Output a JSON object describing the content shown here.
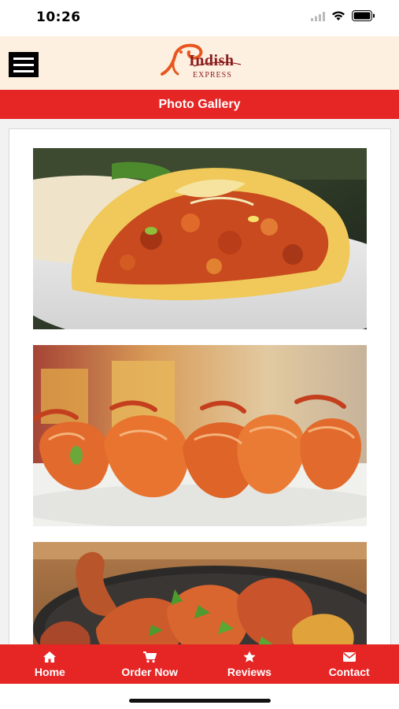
{
  "status_bar": {
    "time": "10:26",
    "icons": [
      "signal-icon",
      "wifi-icon",
      "battery-icon"
    ]
  },
  "header": {
    "menu_icon": "hamburger-menu-icon",
    "logo": {
      "name": "Indish",
      "subtitle": "EXPRESS"
    }
  },
  "page": {
    "title": "Photo Gallery"
  },
  "gallery": {
    "photos": [
      {
        "subject": "burrito-wrap"
      },
      {
        "subject": "grilled-shrimp-skewers"
      },
      {
        "subject": "tandoori-chicken-sizzler"
      }
    ]
  },
  "tabbar": {
    "items": [
      {
        "label": "Home",
        "icon": "home-icon"
      },
      {
        "label": "Order Now",
        "icon": "cart-icon"
      },
      {
        "label": "Reviews",
        "icon": "star-icon"
      },
      {
        "label": "Contact",
        "icon": "envelope-icon"
      }
    ]
  },
  "colors": {
    "brand_red": "#e62525",
    "header_bg": "#fdf0e0",
    "logo_text": "#8a1c1c"
  }
}
